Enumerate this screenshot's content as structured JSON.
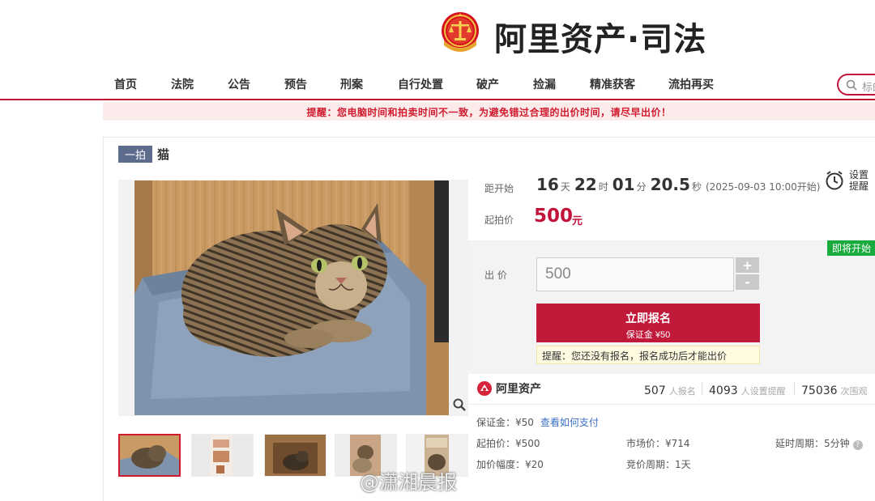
{
  "header": {
    "brand": "阿里资产·司法",
    "logo_icon": "court-emblem-icon"
  },
  "nav": {
    "items": [
      "首页",
      "法院",
      "公告",
      "预告",
      "刑案",
      "自行处置",
      "破产",
      "捡漏",
      "精准获客",
      "流拍再买"
    ],
    "search_placeholder": "标的"
  },
  "warning": "提醒：您电脑时间和拍卖时间不一致，为避免错过合理的出价时间，请尽早出价！",
  "item": {
    "round_tag": "一拍",
    "title": "猫"
  },
  "countdown": {
    "label": "距开始",
    "days": "16",
    "days_unit": "天",
    "hours": "22",
    "hours_unit": "时",
    "minutes": "01",
    "minutes_unit": "分",
    "seconds": "20.5",
    "seconds_unit": "秒",
    "start_time": "(2025-09-03 10:00开始)"
  },
  "remind": {
    "label_line1": "设置",
    "label_line2": "提醒"
  },
  "price": {
    "label": "起拍价",
    "value": "500",
    "unit": "元"
  },
  "bid": {
    "status_badge": "即将开始",
    "label": "出 价",
    "input_value": "500",
    "plus": "+",
    "minus": "-",
    "signup_main": "立即报名",
    "signup_sub": "保证金 ¥50",
    "tip": "提醒：您还没有报名，报名成功后才能出价"
  },
  "stats": {
    "platform": "阿里资产",
    "signups": "507",
    "signups_label": "人报名",
    "reminders": "4093",
    "reminders_label": "人设置提醒",
    "views": "75036",
    "views_label": "次围观"
  },
  "details": {
    "deposit": "保证金：¥50",
    "how_to_pay": "查看如何支付",
    "start_price": "起拍价：¥500",
    "market_price": "市场价：¥714",
    "delay_period": "延时周期：5分钟",
    "increment": "加价幅度：¥20",
    "bid_period": "竞价周期：1天"
  },
  "watermark": "@潇湘晨报",
  "colors": {
    "brand_red": "#c2143a",
    "green_badge": "#1aab3e",
    "tag_blue": "#5d6b8c"
  }
}
